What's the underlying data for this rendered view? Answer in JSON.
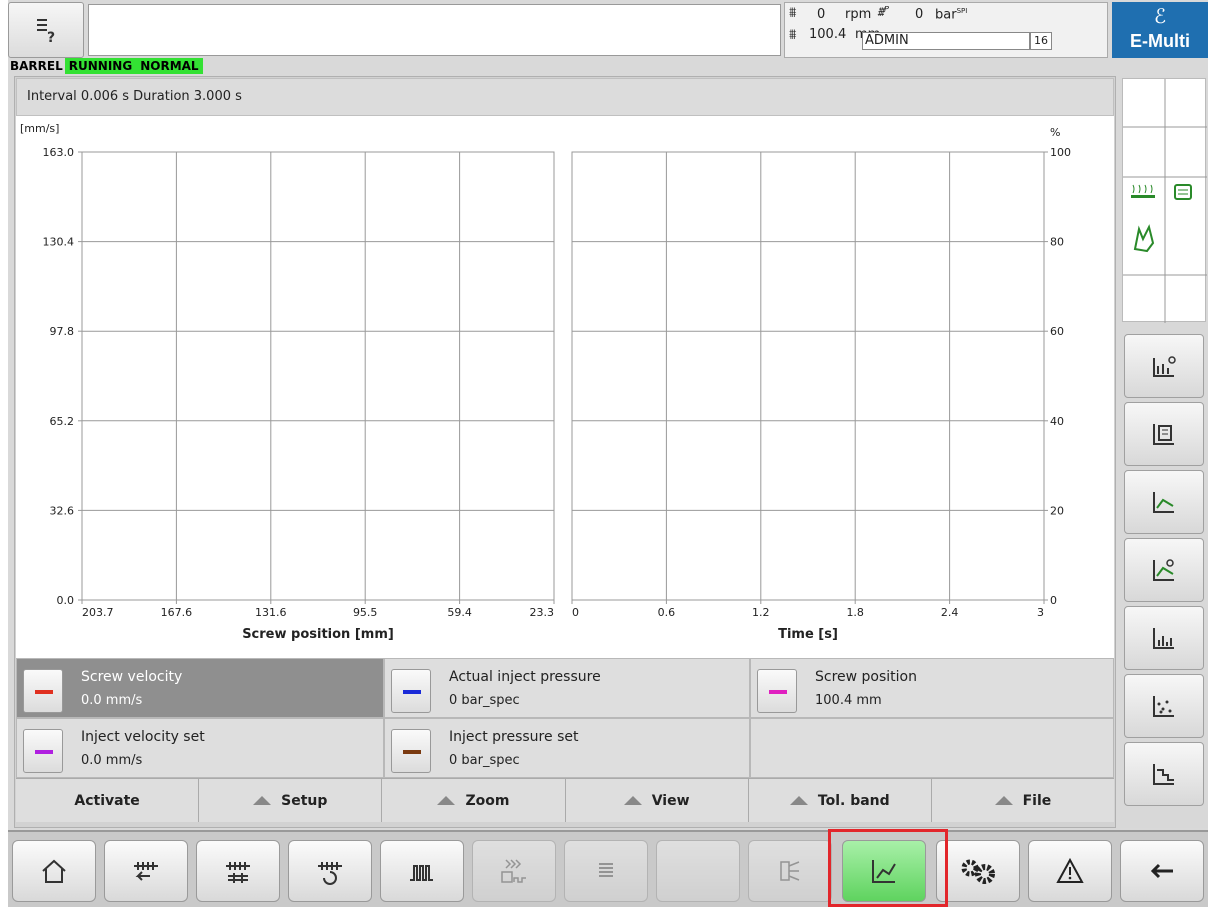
{
  "header": {
    "readout": {
      "rpm_value": "0",
      "rpm_unit": "rpm",
      "pressure_value": "0",
      "pressure_unit": "bar",
      "pressure_unit_sup": "SPI",
      "position_value": "100.4",
      "position_unit": "mm",
      "user": "ADMIN",
      "user_level": "16"
    },
    "logo_text": "E-Multi"
  },
  "status_bar": {
    "module": "BARREL",
    "state1": "RUNNING",
    "state2": "NORMAL"
  },
  "info_bar": {
    "text": "Interval 0.006 s Duration 3.000 s"
  },
  "chart_data": [
    {
      "type": "line",
      "ylabel": "[mm/s]",
      "xlabel": "Screw position [mm]",
      "x_ticks": [
        "203.7",
        "167.6",
        "131.6",
        "95.5",
        "59.4",
        "23.3"
      ],
      "y_ticks": [
        "163.0",
        "130.4",
        "97.8",
        "65.2",
        "32.6",
        "0.0"
      ],
      "xlim": [
        203.7,
        23.3
      ],
      "ylim": [
        0,
        163
      ],
      "grid": true,
      "series": []
    },
    {
      "type": "line",
      "ylabel": "%",
      "xlabel": "Time [s]",
      "x_ticks": [
        "0",
        "0.6",
        "1.2",
        "1.8",
        "2.4",
        "3"
      ],
      "y_ticks": [
        "100",
        "80",
        "60",
        "40",
        "20",
        "0"
      ],
      "xlim": [
        0,
        3
      ],
      "ylim": [
        0,
        100
      ],
      "grid": true,
      "series": []
    }
  ],
  "legend": [
    {
      "name": "Screw velocity",
      "value": "0.0 mm/s",
      "color": "#e03020",
      "selected": true
    },
    {
      "name": "Actual inject pressure",
      "value": "0 bar_spec",
      "color": "#1a2ad8",
      "selected": false
    },
    {
      "name": "Screw position",
      "value": "100.4 mm",
      "color": "#e020c0",
      "selected": false
    },
    {
      "name": "Inject velocity set",
      "value": "0.0 mm/s",
      "color": "#b020e0",
      "selected": false
    },
    {
      "name": "Inject pressure set",
      "value": "0 bar_spec",
      "color": "#7a3a10",
      "selected": false
    }
  ],
  "menu": {
    "activate": "Activate",
    "setup": "Setup",
    "zoom": "Zoom",
    "view": "View",
    "tol_band": "Tol. band",
    "file": "File"
  },
  "bottom_nav": [
    "home-icon",
    "injection-icon",
    "hold-pressure-icon",
    "plasticizing-icon",
    "mold-temperature-icon",
    "ejector-icon",
    "list-icon",
    "blank",
    "nozzle-icon",
    "graph-icon",
    "settings-icon",
    "alarm-icon",
    "back-arrow-icon"
  ],
  "colors": {
    "accent_green": "#33e133",
    "highlight_red": "#e2262b",
    "logo_blue": "#1f6fb0"
  }
}
